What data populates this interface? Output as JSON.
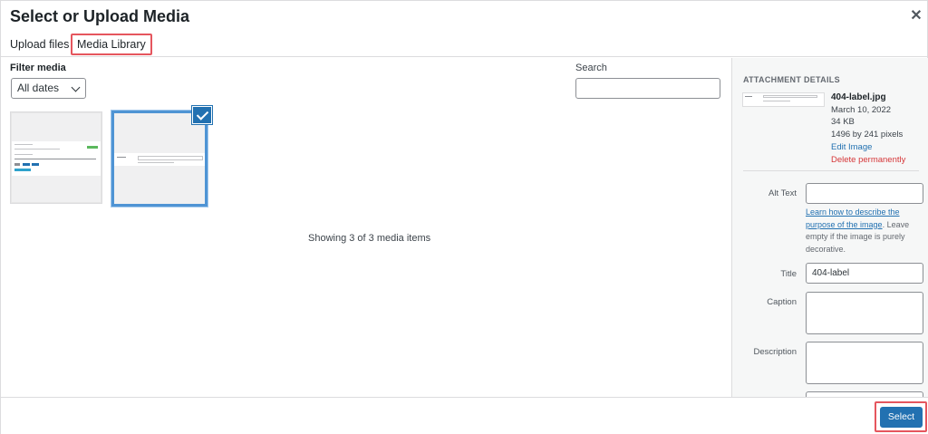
{
  "modal": {
    "title": "Select or Upload Media",
    "close_icon": "close-icon"
  },
  "tabs": [
    {
      "label": "Upload files",
      "active": false
    },
    {
      "label": "Media Library",
      "active": true
    }
  ],
  "filter": {
    "label": "Filter media",
    "selected": "All dates"
  },
  "search": {
    "label": "Search",
    "value": ""
  },
  "grid": {
    "items": [
      {
        "name": "media-item-1",
        "selected": false
      },
      {
        "name": "media-item-2",
        "selected": true
      }
    ],
    "count_text": "Showing 3 of 3 media items"
  },
  "details": {
    "heading": "ATTACHMENT DETAILS",
    "filename": "404-label.jpg",
    "date": "March 10, 2022",
    "size": "34 KB",
    "dimensions": "1496 by 241 pixels",
    "edit_link": "Edit Image",
    "delete_link": "Delete permanently",
    "alt_label": "Alt Text",
    "alt_value": "",
    "alt_help_link": "Learn how to describe the purpose of the image",
    "alt_help_text": ". Leave empty if the image is purely decorative.",
    "title_label": "Title",
    "title_value": "404-label",
    "caption_label": "Caption",
    "caption_value": "",
    "description_label": "Description",
    "description_value": ""
  },
  "footer": {
    "select_label": "Select"
  },
  "colors": {
    "primary": "#2271b1",
    "danger": "#d63638",
    "highlight_outline": "#e5565e",
    "selected_border": "#4f94d4"
  }
}
